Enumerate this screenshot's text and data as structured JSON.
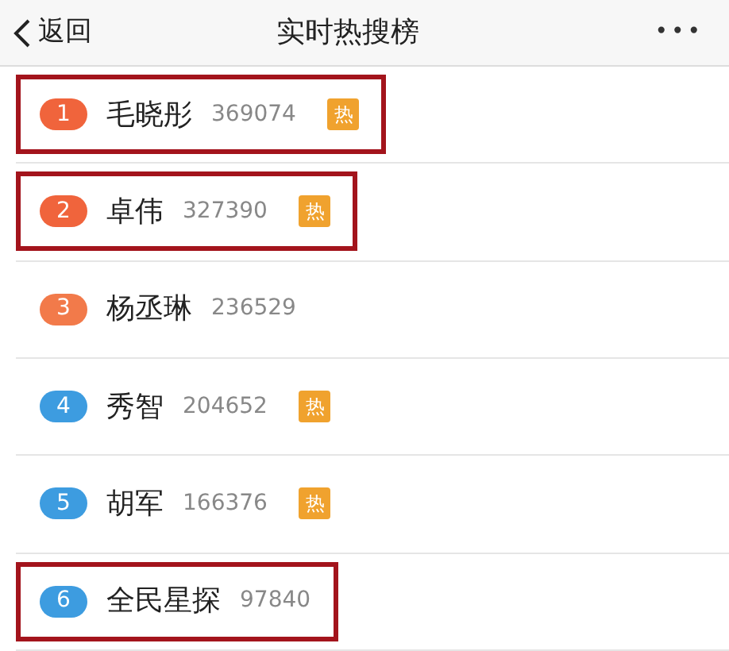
{
  "header": {
    "back_label": "返回",
    "title": "实时热搜榜",
    "more": "•••"
  },
  "items": [
    {
      "rank": "1",
      "color": "#f0643c",
      "name": "毛晓彤",
      "count": "369074",
      "hot": true,
      "hot_label": "热",
      "highlighted": true
    },
    {
      "rank": "2",
      "color": "#f0643c",
      "name": "卓伟",
      "count": "327390",
      "hot": true,
      "hot_label": "热",
      "highlighted": true
    },
    {
      "rank": "3",
      "color": "#f27a4a",
      "name": "杨丞琳",
      "count": "236529",
      "hot": false,
      "highlighted": false
    },
    {
      "rank": "4",
      "color": "#3d9ce0",
      "name": "秀智",
      "count": "204652",
      "hot": true,
      "hot_label": "热",
      "highlighted": false
    },
    {
      "rank": "5",
      "color": "#3d9ce0",
      "name": "胡军",
      "count": "166376",
      "hot": true,
      "hot_label": "热",
      "highlighted": false
    },
    {
      "rank": "6",
      "color": "#3d9ce0",
      "name": "全民星探",
      "count": "97840",
      "hot": false,
      "highlighted": true
    }
  ]
}
